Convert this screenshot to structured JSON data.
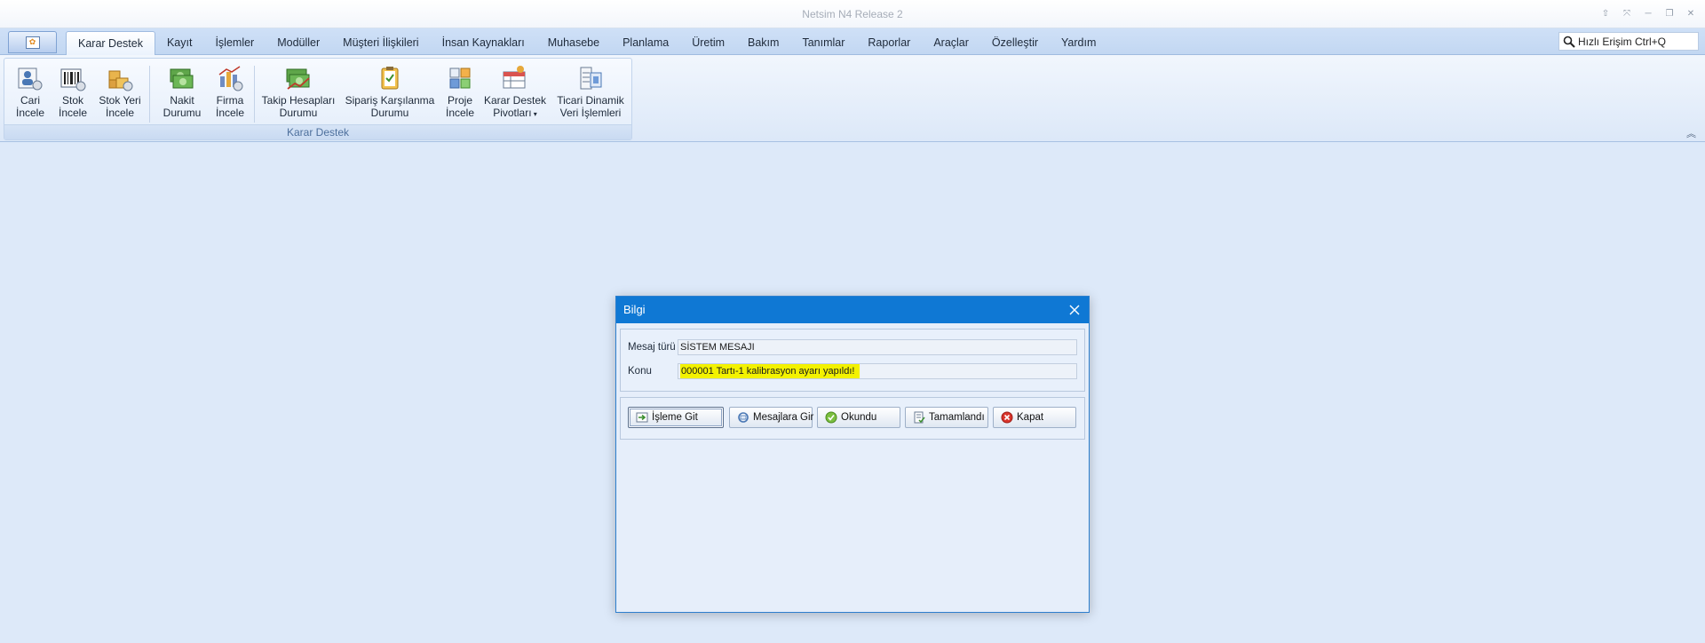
{
  "window": {
    "title": "Netsim N4 Release 2",
    "controls": [
      "pin-icon",
      "restore-small-icon",
      "minimize-icon",
      "maximize-icon",
      "close-icon"
    ]
  },
  "tabs": [
    {
      "label": "Karar Destek",
      "active": true
    },
    {
      "label": "Kayıt"
    },
    {
      "label": "İşlemler"
    },
    {
      "label": "Modüller"
    },
    {
      "label": "Müşteri İlişkileri"
    },
    {
      "label": "İnsan Kaynakları"
    },
    {
      "label": "Muhasebe"
    },
    {
      "label": "Planlama"
    },
    {
      "label": "Üretim"
    },
    {
      "label": "Bakım"
    },
    {
      "label": "Tanımlar"
    },
    {
      "label": "Raporlar"
    },
    {
      "label": "Araçlar"
    },
    {
      "label": "Özelleştir"
    },
    {
      "label": "Yardım"
    }
  ],
  "quick_access": {
    "label": "Hızlı Erişim Ctrl+Q"
  },
  "ribbon": {
    "group_caption": "Karar Destek",
    "items": [
      {
        "line1": "Cari",
        "line2": "İncele",
        "icon": "customer-card-icon"
      },
      {
        "line1": "Stok",
        "line2": "İncele",
        "icon": "barcode-icon"
      },
      {
        "line1": "Stok Yeri",
        "line2": "İncele",
        "icon": "warehouse-boxes-icon"
      },
      {
        "line1": "Nakit",
        "line2": "Durumu",
        "icon": "cash-icon"
      },
      {
        "line1": "Firma",
        "line2": "İncele",
        "icon": "company-chart-icon"
      },
      {
        "line1": "Takip Hesapları",
        "line2": "Durumu",
        "icon": "tracking-cash-icon"
      },
      {
        "line1": "Sipariş Karşılanma",
        "line2": "Durumu",
        "icon": "clipboard-check-icon"
      },
      {
        "line1": "Proje",
        "line2": "İncele",
        "icon": "project-grid-icon"
      },
      {
        "line1": "Karar Destek",
        "line2": "Pivotları",
        "icon": "pivot-table-icon"
      },
      {
        "line1": "Ticari Dinamik",
        "line2": "Veri İşlemleri",
        "icon": "dynamic-data-icon"
      }
    ]
  },
  "dialog": {
    "title": "Bilgi",
    "message_type_label": "Mesaj türü",
    "message_type_value": "SİSTEM MESAJI",
    "subject_label": "Konu",
    "subject_value": "000001 Tartı-1 kalibrasyon ayarı yapıldı!",
    "buttons": {
      "goto": "İşleme Git",
      "messages": "Mesajlara Gir",
      "read": "Okundu",
      "done": "Tamamlandı",
      "close": "Kapat"
    }
  },
  "colors": {
    "dialog_title_bg": "#0f78d4",
    "highlight": "#f3f200",
    "workspace_bg": "#dde9f9"
  }
}
